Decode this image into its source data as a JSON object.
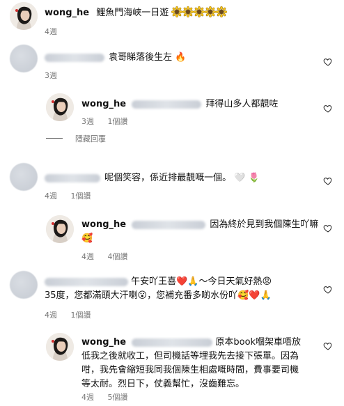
{
  "post": {
    "username": "wong_he",
    "caption": "鯉魚門海峽一日遊",
    "caption_emojis": [
      "sunflower",
      "sunflower",
      "sunflower",
      "sunflower",
      "sunflower"
    ],
    "time": "4週"
  },
  "comments": [
    {
      "text": "袁哥睇落後生左",
      "emoji": "fire",
      "time": "3週",
      "hide_replies": "隱藏回覆",
      "reply": {
        "username": "wong_he",
        "text": "拜得山多人都靚咗",
        "time": "3週",
        "likes": "1個讚"
      }
    },
    {
      "text": "呢個笑容，係近排最靚嘅一個。",
      "time": "4週",
      "likes": "1個讚",
      "reply": {
        "username": "wong_he",
        "text": "因為終於見到我個陳生吖嘛",
        "time": "4週",
        "likes": "4個讚"
      }
    },
    {
      "text_a": "午安吖王喜",
      "text_b": "～今日天氣好熱",
      "text_c": "35度，您都滿頭大汗喇",
      "text_d": "，您補充番多啲水份吖",
      "time": "4週",
      "likes": "1個讚",
      "reply": {
        "username": "wong_he",
        "line1": "原本book嗰架車唔放",
        "line2": "低我之後就收工，但司機話等埋我先去接下張單。因為",
        "line3": "咁，我先會縮短我同我個陳生相處嘅時間，費事要司機",
        "line4": "等太耐。烈日下，仗義幫忙，沒齒難忘。",
        "time": "4週",
        "likes": "5個讚"
      }
    }
  ],
  "colors": {
    "meta": "#777777",
    "heart": "#262626",
    "divider": "#555555"
  }
}
